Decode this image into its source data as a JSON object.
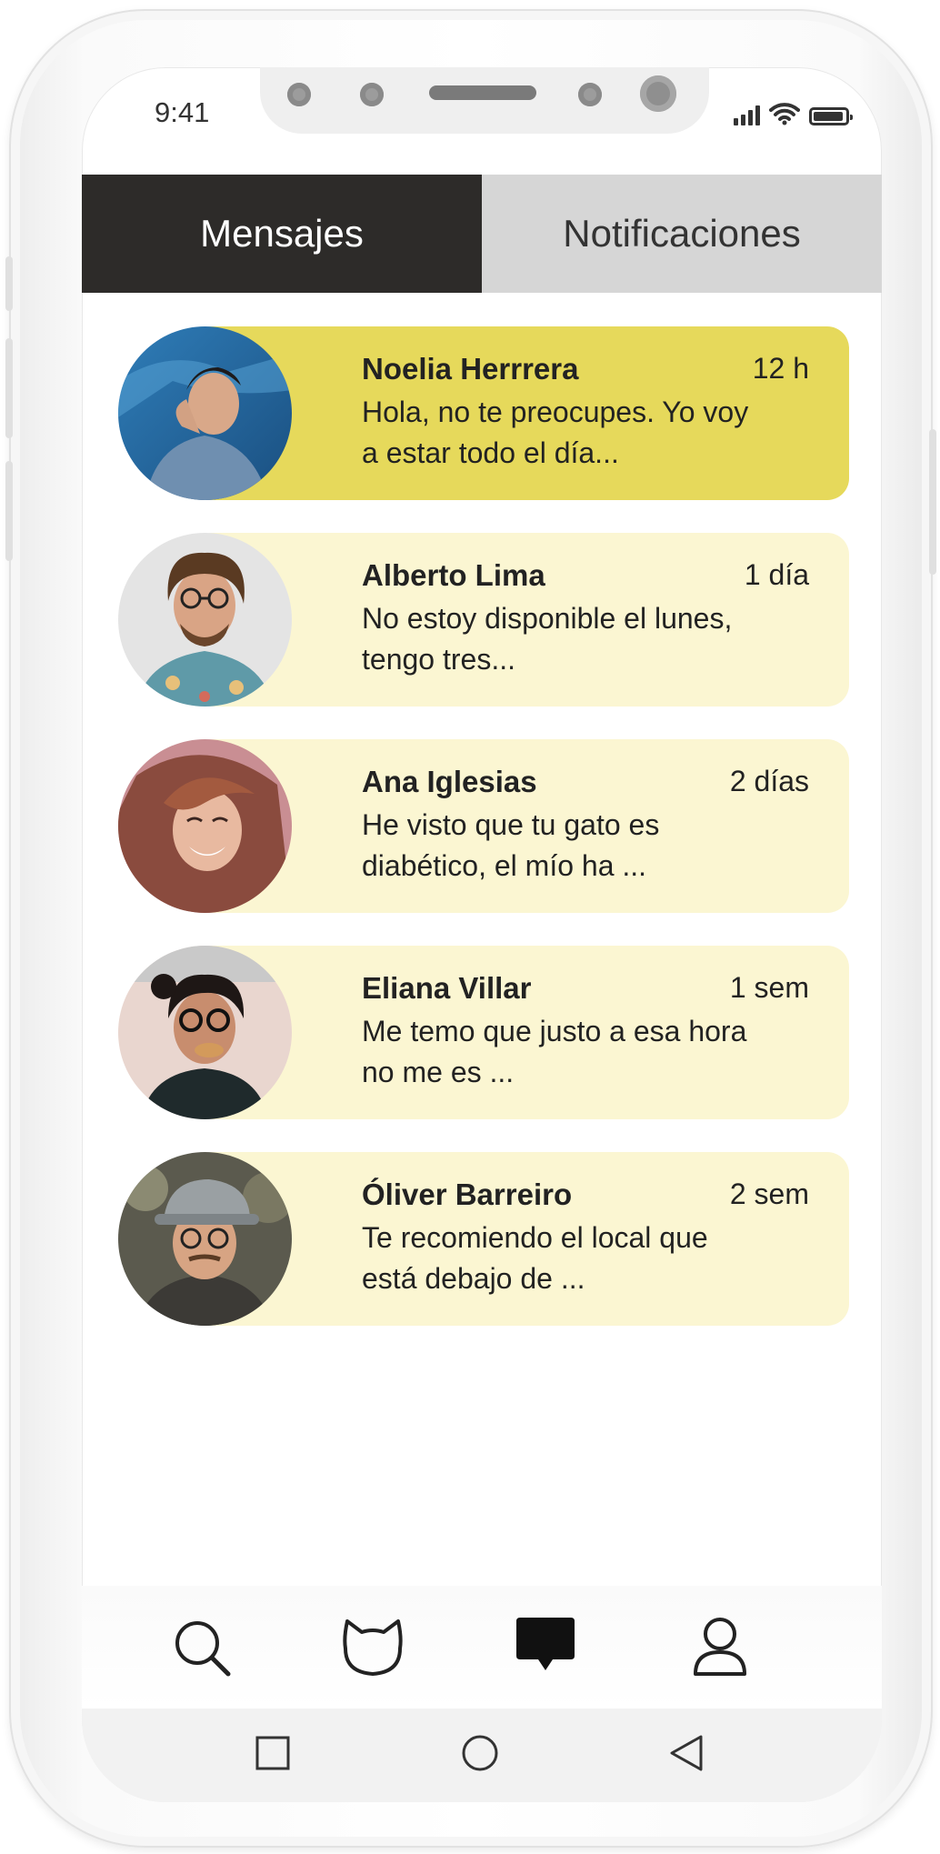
{
  "status_bar": {
    "time": "9:41"
  },
  "tabs": [
    {
      "label": "Mensajes",
      "active": true
    },
    {
      "label": "Notificaciones",
      "active": false
    }
  ],
  "messages": [
    {
      "name": "Noelia Herrrera",
      "time": "12 h",
      "preview": "Hola, no te preocupes. Yo voy a estar todo el día...",
      "highlighted": true
    },
    {
      "name": "Alberto Lima",
      "time": "1 día",
      "preview": "No estoy disponible el lunes, tengo tres...",
      "highlighted": false
    },
    {
      "name": "Ana Iglesias",
      "time": "2 días",
      "preview": "He visto que tu gato es diabético, el mío ha ...",
      "highlighted": false
    },
    {
      "name": "Eliana Villar",
      "time": "1 sem",
      "preview": "Me temo que justo a esa hora no me es ...",
      "highlighted": false
    },
    {
      "name": "Óliver Barreiro",
      "time": "2 sem",
      "preview": "Te recomiendo el local que está debajo de ...",
      "highlighted": false
    }
  ],
  "bottom_nav": [
    {
      "icon": "search-icon"
    },
    {
      "icon": "cat-icon"
    },
    {
      "icon": "chat-bubble-icon",
      "active": true
    },
    {
      "icon": "user-icon"
    }
  ],
  "system_nav": [
    {
      "icon": "square-icon"
    },
    {
      "icon": "circle-icon"
    },
    {
      "icon": "back-triangle-icon"
    }
  ],
  "colors": {
    "active_tab": "#2d2b29",
    "inactive_tab": "#d6d6d6",
    "highlight_card": "#e6d95b",
    "card": "#fbf6d2"
  }
}
